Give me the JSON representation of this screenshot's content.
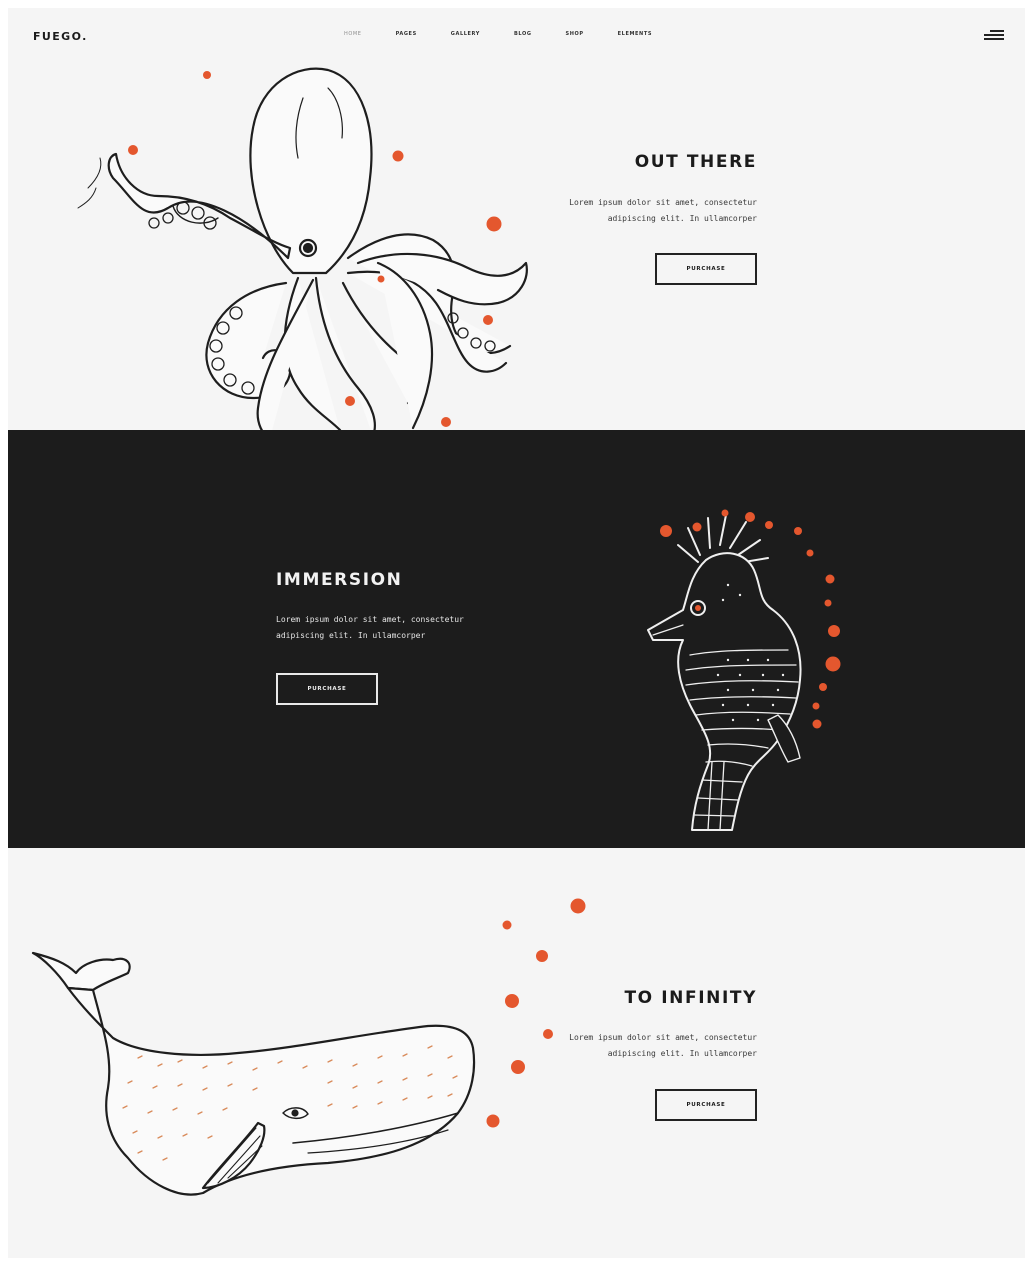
{
  "header": {
    "logo": "FUEGO.",
    "nav": [
      "HOME",
      "PAGES",
      "GALLERY",
      "BLOG",
      "SHOP",
      "ELEMENTS"
    ],
    "active_nav": "HOME"
  },
  "sections": [
    {
      "title": "OUT THERE",
      "description_line1": "Lorem ipsum dolor sit amet, consectetur",
      "description_line2": "adipiscing elit. In ullamcorper",
      "button": "PURCHASE",
      "illustration": "octopus-illustration"
    },
    {
      "title": "IMMERSION",
      "description_line1": "Lorem ipsum dolor sit amet, consectetur",
      "description_line2": "adipiscing elit. In ullamcorper",
      "button": "PURCHASE",
      "illustration": "seahorse-illustration"
    },
    {
      "title": "TO INFINITY",
      "description_line1": "Lorem ipsum dolor sit amet, consectetur",
      "description_line2": "adipiscing elit. In ullamcorper",
      "button": "PURCHASE",
      "illustration": "whale-illustration"
    }
  ],
  "colors": {
    "accent": "#e4572e",
    "dark_band": "#1c1c1c",
    "light_bg": "#f5f5f5"
  }
}
